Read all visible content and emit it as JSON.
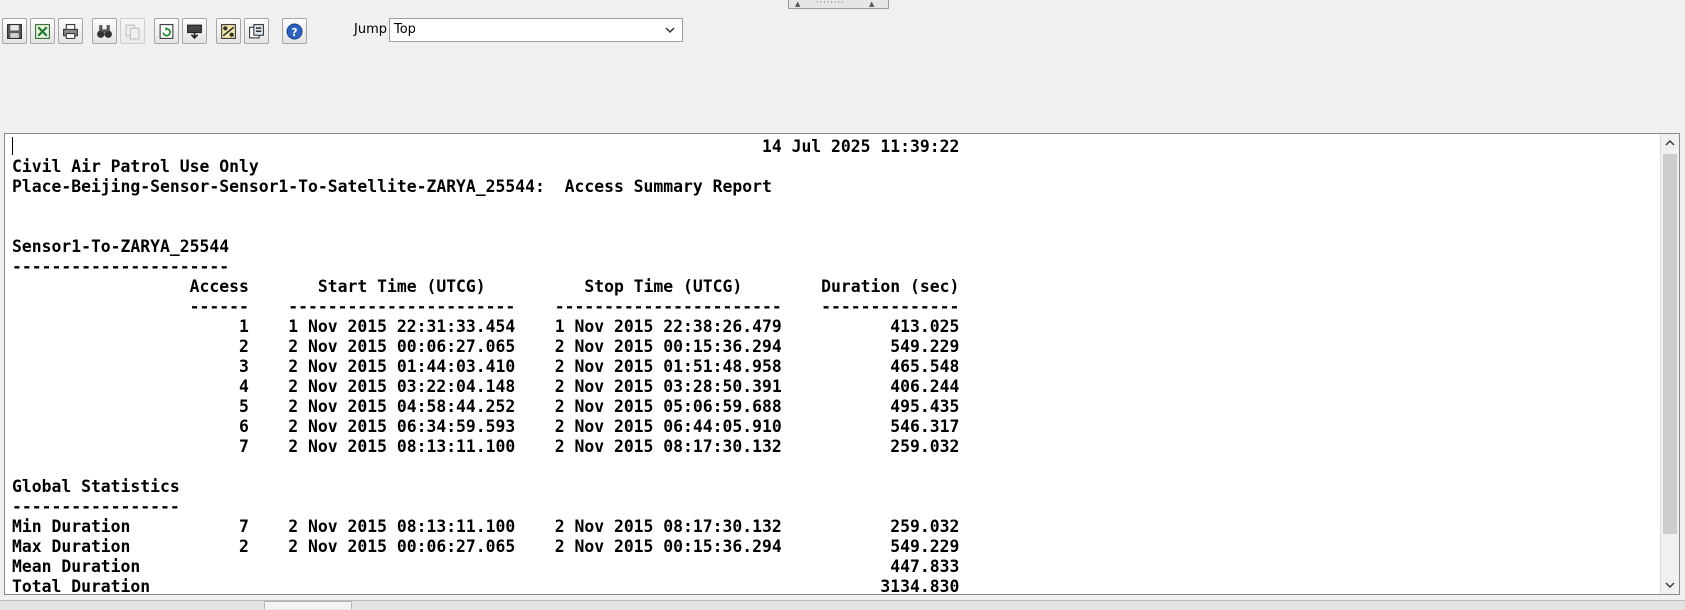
{
  "toolbar": {
    "buttons": [
      {
        "icon": "save-icon"
      },
      {
        "icon": "export-excel-icon"
      },
      {
        "icon": "print-icon"
      },
      {
        "icon": "find-icon"
      },
      {
        "icon": "copy-icon",
        "disabled": true
      },
      {
        "icon": "refresh-icon"
      },
      {
        "icon": "download-icon"
      },
      {
        "icon": "graph-options-icon"
      },
      {
        "icon": "report-manager-icon"
      },
      {
        "icon": "help-icon",
        "glyph": "?"
      }
    ]
  },
  "jump": {
    "label": "Jump",
    "value": "Top"
  },
  "report": {
    "timestamp": "14 Jul 2025 11:39:22",
    "classification": "Civil Air Patrol Use Only",
    "title": "Place-Beijing-Sensor-Sensor1-To-Satellite-ZARYA_25544:  Access Summary Report",
    "section": "Sensor1-To-ZARYA_25544",
    "columns": [
      "Access",
      "Start Time (UTCG)",
      "Stop Time (UTCG)",
      "Duration (sec)"
    ],
    "rows": [
      {
        "access": "1",
        "start": "1 Nov 2015 22:31:33.454",
        "stop": "1 Nov 2015 22:38:26.479",
        "duration": "413.025"
      },
      {
        "access": "2",
        "start": "2 Nov 2015 00:06:27.065",
        "stop": "2 Nov 2015 00:15:36.294",
        "duration": "549.229"
      },
      {
        "access": "3",
        "start": "2 Nov 2015 01:44:03.410",
        "stop": "2 Nov 2015 01:51:48.958",
        "duration": "465.548"
      },
      {
        "access": "4",
        "start": "2 Nov 2015 03:22:04.148",
        "stop": "2 Nov 2015 03:28:50.391",
        "duration": "406.244"
      },
      {
        "access": "5",
        "start": "2 Nov 2015 04:58:44.252",
        "stop": "2 Nov 2015 05:06:59.688",
        "duration": "495.435"
      },
      {
        "access": "6",
        "start": "2 Nov 2015 06:34:59.593",
        "stop": "2 Nov 2015 06:44:05.910",
        "duration": "546.317"
      },
      {
        "access": "7",
        "start": "2 Nov 2015 08:13:11.100",
        "stop": "2 Nov 2015 08:17:30.132",
        "duration": "259.032"
      }
    ],
    "global_title": "Global Statistics",
    "stats": [
      {
        "label": "Min Duration",
        "access": "7",
        "start": "2 Nov 2015 08:13:11.100",
        "stop": "2 Nov 2015 08:17:30.132",
        "duration": "259.032"
      },
      {
        "label": "Max Duration",
        "access": "2",
        "start": "2 Nov 2015 00:06:27.065",
        "stop": "2 Nov 2015 00:15:36.294",
        "duration": "549.229"
      },
      {
        "label": "Mean Duration",
        "access": "",
        "start": "",
        "stop": "",
        "duration": "447.833"
      },
      {
        "label": "Total Duration",
        "access": "",
        "start": "",
        "stop": "",
        "duration": "3134.830"
      }
    ]
  }
}
